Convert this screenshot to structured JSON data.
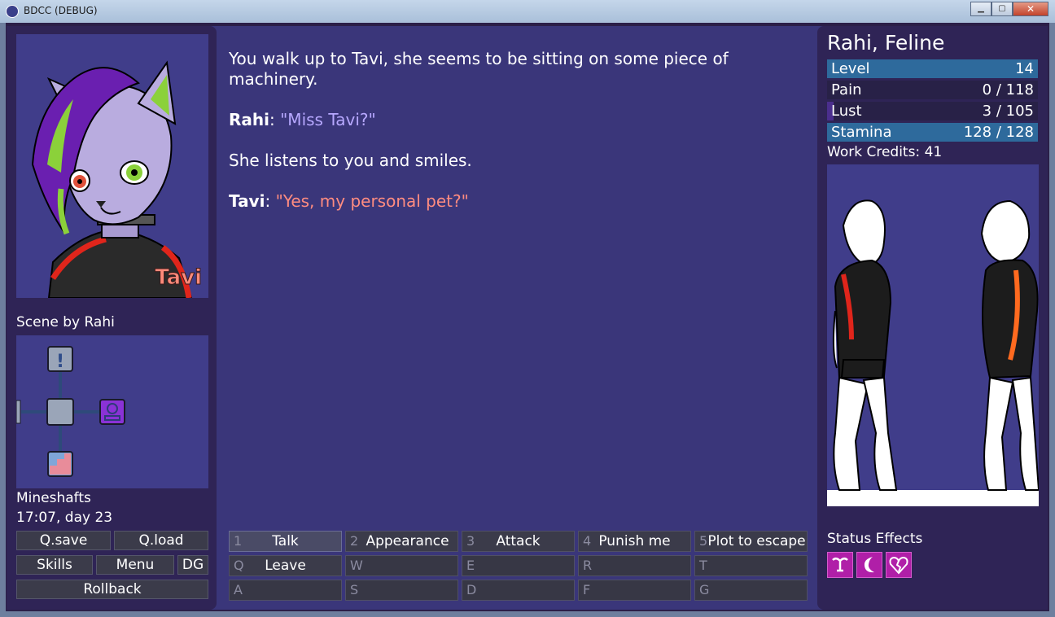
{
  "window": {
    "title": "BDCC (DEBUG)",
    "minimize": "▁",
    "maximize": "▢",
    "close": "✕"
  },
  "portrait": {
    "name": "Tavi"
  },
  "scene_by": "Scene by Rahi",
  "map": {
    "icons": [
      "exclamation-icon",
      "person-icon",
      "stairs-icon"
    ]
  },
  "location": {
    "name": "Mineshafts",
    "time": "17:07, day 23"
  },
  "left_buttons": {
    "qsave": "Q.save",
    "qload": "Q.load",
    "skills": "Skills",
    "menu": "Menu",
    "dg": "DG",
    "rollback": "Rollback"
  },
  "story": {
    "line1": "You walk up to Tavi, she seems to be sitting on some piece of machinery.",
    "speaker1": "Rahi",
    "quote1": "\"Miss Tavi?\"",
    "line2": "She listens to you and smiles.",
    "speaker2": "Tavi",
    "quote2": "\"Yes, my personal pet?\""
  },
  "actions": [
    {
      "key": "1",
      "label": "Talk"
    },
    {
      "key": "2",
      "label": "Appearance"
    },
    {
      "key": "3",
      "label": "Attack"
    },
    {
      "key": "4",
      "label": "Punish me"
    },
    {
      "key": "5",
      "label": "Plot to escape"
    },
    {
      "key": "Q",
      "label": "Leave"
    },
    {
      "key": "W",
      "label": ""
    },
    {
      "key": "E",
      "label": ""
    },
    {
      "key": "R",
      "label": ""
    },
    {
      "key": "T",
      "label": ""
    },
    {
      "key": "A",
      "label": ""
    },
    {
      "key": "S",
      "label": ""
    },
    {
      "key": "D",
      "label": ""
    },
    {
      "key": "F",
      "label": ""
    },
    {
      "key": "G",
      "label": ""
    }
  ],
  "character": {
    "name": "Rahi, Feline",
    "stats": [
      {
        "name": "Level",
        "value": "14",
        "fill_fraction": 1.0,
        "kind": "level"
      },
      {
        "name": "Pain",
        "value": "0 / 118",
        "fill_fraction": 0.0,
        "kind": "pain"
      },
      {
        "name": "Lust",
        "value": "3 / 105",
        "fill_fraction": 0.03,
        "kind": "lust"
      },
      {
        "name": "Stamina",
        "value": "128 / 128",
        "fill_fraction": 1.0,
        "kind": "stamina"
      }
    ],
    "credits": "Work Credits: 41"
  },
  "status": {
    "title": "Status Effects",
    "icons": [
      "uterus-icon",
      "moon-icon",
      "broken-heart-icon"
    ]
  },
  "colors": {
    "panel": "#2f2456",
    "main_bg": "#3a367a",
    "rahi_quote": "#b7a8ff",
    "tavi_quote": "#ff8c80",
    "stat_fill": "#2e6a9c",
    "status_icon_bg": "#b01fa8"
  }
}
